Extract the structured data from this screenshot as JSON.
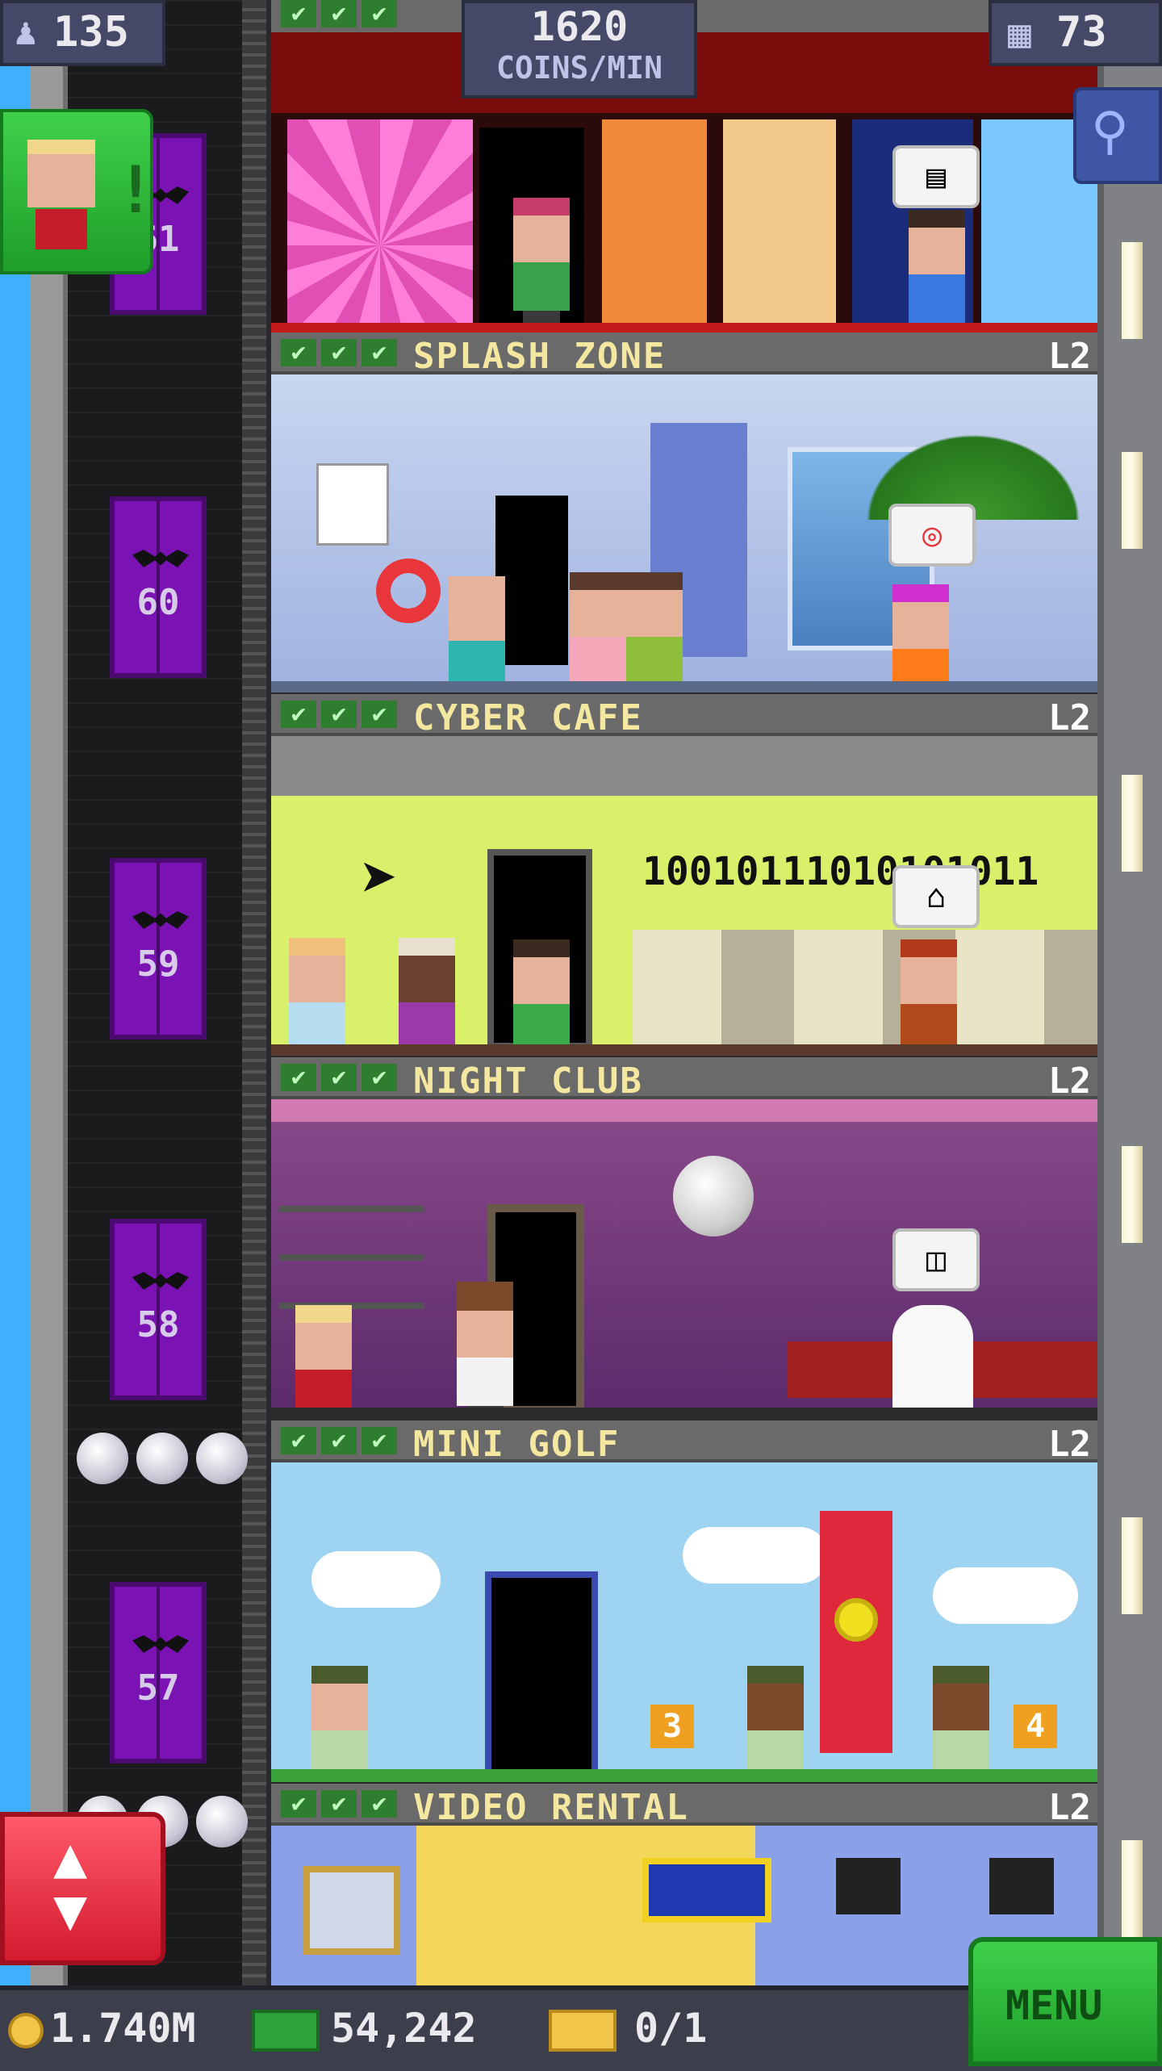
{
  "topbar": {
    "population": "135",
    "coins_rate_value": "1620",
    "coins_rate_unit": "COINS/MIN",
    "floors_count": "73"
  },
  "floors": [
    {
      "name": "SPLASH ZONE",
      "level": "L2",
      "elevator_number": "60",
      "bubble": "life-ring"
    },
    {
      "name": "CYBER CAFE",
      "level": "L2",
      "elevator_number": "59",
      "binary_text": "10010111010101011"
    },
    {
      "name": "NIGHT CLUB",
      "level": "L2",
      "elevator_number": "58"
    },
    {
      "name": "MINI GOLF",
      "level": "L2",
      "elevator_number": "57",
      "holes": [
        "3",
        "4"
      ]
    },
    {
      "name": "VIDEO RENTAL",
      "level": "L2"
    }
  ],
  "top_floor": {
    "elevator_number": "61"
  },
  "bottombar": {
    "coins": "1.740M",
    "bux": "54,242",
    "tickets": "0/1",
    "menu_label": "MENU"
  },
  "colors": {
    "elevator_purple": "#7a12b4",
    "menu_green": "#22b52a",
    "elevator_button_red": "#e8283c",
    "floor_label_yellow": "#f4e8a0"
  }
}
